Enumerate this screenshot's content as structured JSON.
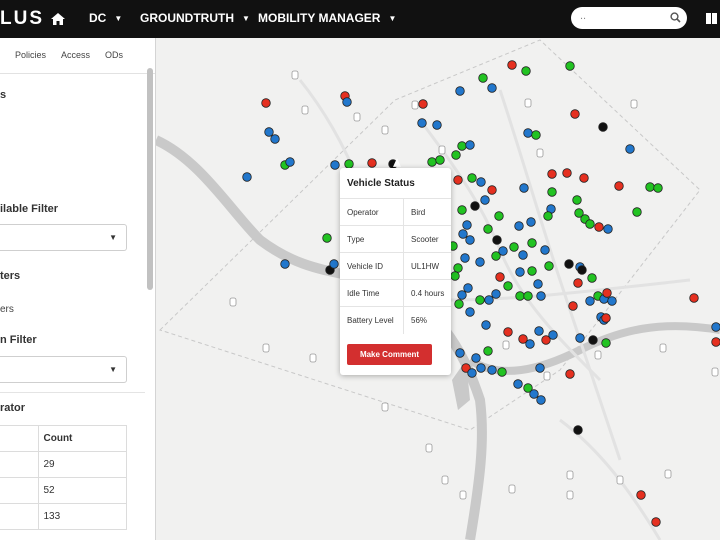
{
  "app": {
    "logo": "LUS"
  },
  "nav": {
    "city": "DC",
    "groundtruth": "GROUNDTRUTH",
    "mobility_manager": "MOBILITY MANAGER"
  },
  "search": {
    "placeholder": ".."
  },
  "sidebar": {
    "tabs": [
      "Policies",
      "Access",
      "ODs"
    ],
    "heading_top": "s",
    "available_filter_label": "ilable Filter",
    "filters_label": "ters",
    "filters_sub": "ers",
    "location_filter_label": "n Filter",
    "operator_label": "rator",
    "table": {
      "header": [
        "",
        "Count"
      ],
      "rows": [
        [
          "",
          "29"
        ],
        [
          "",
          "52"
        ],
        [
          "",
          "133"
        ]
      ]
    }
  },
  "popup": {
    "title": "Vehicle Status",
    "rows": [
      {
        "key": "Operator",
        "value": "Bird"
      },
      {
        "key": "Type",
        "value": "Scooter"
      },
      {
        "key": "Vehicle ID",
        "value": "UL1HW"
      },
      {
        "key": "Idle Time",
        "value": "0.4 hours"
      },
      {
        "key": "Battery Level",
        "value": "56%"
      }
    ],
    "button": "Make Comment"
  },
  "colors": {
    "topbar": "#111111",
    "green": "#22c322",
    "blue": "#2277cc",
    "red": "#e53020",
    "black": "#111111",
    "button": "#d32f2f"
  }
}
